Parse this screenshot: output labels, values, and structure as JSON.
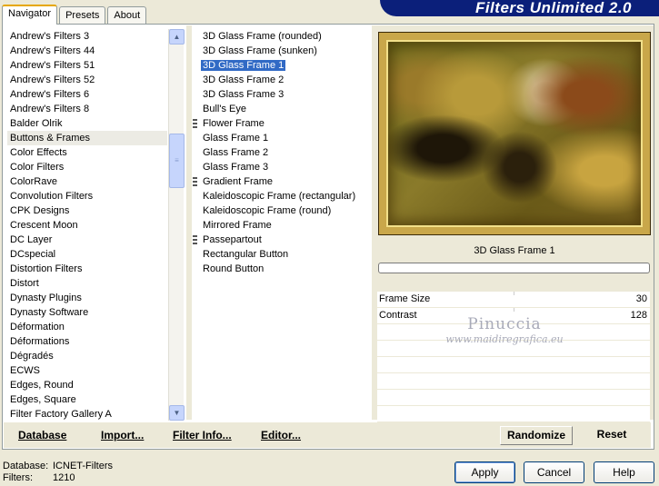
{
  "header": {
    "title": "Filters Unlimited 2.0"
  },
  "tabs": [
    {
      "label": "Navigator",
      "active": true
    },
    {
      "label": "Presets",
      "active": false
    },
    {
      "label": "About",
      "active": false
    }
  ],
  "categories": {
    "items": [
      "Andrew's Filters 3",
      "Andrew's Filters 44",
      "Andrew's Filters 51",
      "Andrew's Filters 52",
      "Andrew's Filters 6",
      "Andrew's Filters 8",
      "Balder Olrik",
      "Buttons & Frames",
      "Color Effects",
      "Color Filters",
      "ColorRave",
      "Convolution Filters",
      "CPK Designs",
      "Crescent Moon",
      "DC Layer",
      "DCspecial",
      "Distortion Filters",
      "Distort",
      "Dynasty Plugins",
      "Dynasty Software",
      "Déformation",
      "Déformations",
      "Dégradés",
      "ECWS",
      "Edges, Round",
      "Edges, Square",
      "Filter Factory Gallery A"
    ],
    "selected": "Buttons & Frames"
  },
  "filters": {
    "items": [
      {
        "label": "3D Glass Frame (rounded)",
        "grip": false
      },
      {
        "label": "3D Glass Frame (sunken)",
        "grip": false
      },
      {
        "label": "3D Glass Frame 1",
        "grip": false
      },
      {
        "label": "3D Glass Frame 2",
        "grip": false
      },
      {
        "label": "3D Glass Frame 3",
        "grip": false
      },
      {
        "label": "Bull's Eye",
        "grip": false
      },
      {
        "label": "Flower Frame",
        "grip": true
      },
      {
        "label": "Glass Frame 1",
        "grip": false
      },
      {
        "label": "Glass Frame 2",
        "grip": false
      },
      {
        "label": "Glass Frame 3",
        "grip": false
      },
      {
        "label": "Gradient Frame",
        "grip": true
      },
      {
        "label": "Kaleidoscopic Frame (rectangular)",
        "grip": false
      },
      {
        "label": "Kaleidoscopic Frame (round)",
        "grip": false
      },
      {
        "label": "Mirrored Frame",
        "grip": false
      },
      {
        "label": "Passepartout",
        "grip": true
      },
      {
        "label": "Rectangular Button",
        "grip": false
      },
      {
        "label": "Round Button",
        "grip": false
      }
    ],
    "selected": "3D Glass Frame 1"
  },
  "preview": {
    "filter_name": "3D Glass Frame 1",
    "progress": 0
  },
  "params": [
    {
      "name": "Frame Size",
      "value": "30"
    },
    {
      "name": "Contrast",
      "value": "128"
    }
  ],
  "watermark": {
    "line1": "Pinuccia",
    "line2": "www.maidiregrafica.eu"
  },
  "toolbar": {
    "database": "Database",
    "import": "Import...",
    "filter_info": "Filter Info...",
    "editor": "Editor...",
    "randomize": "Randomize",
    "reset": "Reset"
  },
  "status": {
    "database_label": "Database:",
    "database_value": "ICNET-Filters",
    "filters_label": "Filters:",
    "filters_value": "1210"
  },
  "buttons": {
    "apply": "Apply",
    "cancel": "Cancel",
    "help": "Help"
  },
  "colors": {
    "banner": "#0b1f7a",
    "selection": "#316ac5",
    "dialog": "#ece9d8"
  }
}
